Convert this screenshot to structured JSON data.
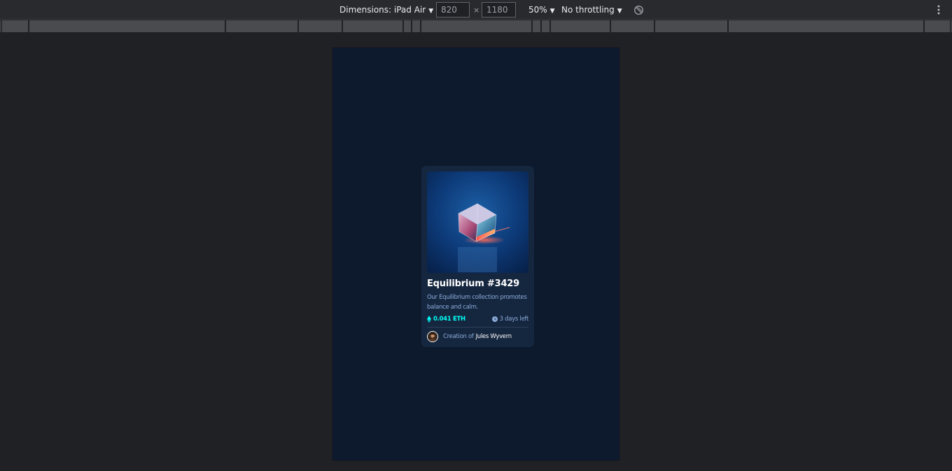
{
  "toolbar": {
    "device_label": "Dimensions: iPad Air",
    "width_value": "820",
    "times_symbol": "×",
    "height_value": "1180",
    "zoom_label": "50%",
    "throttle_label": "No throttling"
  },
  "card": {
    "title": "Equilibrium #3429",
    "description": "Our Equilibrium collection promotes balance and calm.",
    "price": "0.041 ETH",
    "time_left": "3 days left",
    "creator_prefix": "Creation of",
    "creator_name": "Jules Wyvern",
    "icons": {
      "price": "ethereum-icon",
      "time": "clock-icon",
      "rotate": "rotate-icon",
      "more": "more-vertical-icon"
    }
  },
  "colors": {
    "page_bg": "#0d192c",
    "card_bg": "#15263f",
    "cyan_accent": "#00fff8",
    "soft_blue_text": "#8bacd9",
    "devtools_bg": "#202124"
  }
}
